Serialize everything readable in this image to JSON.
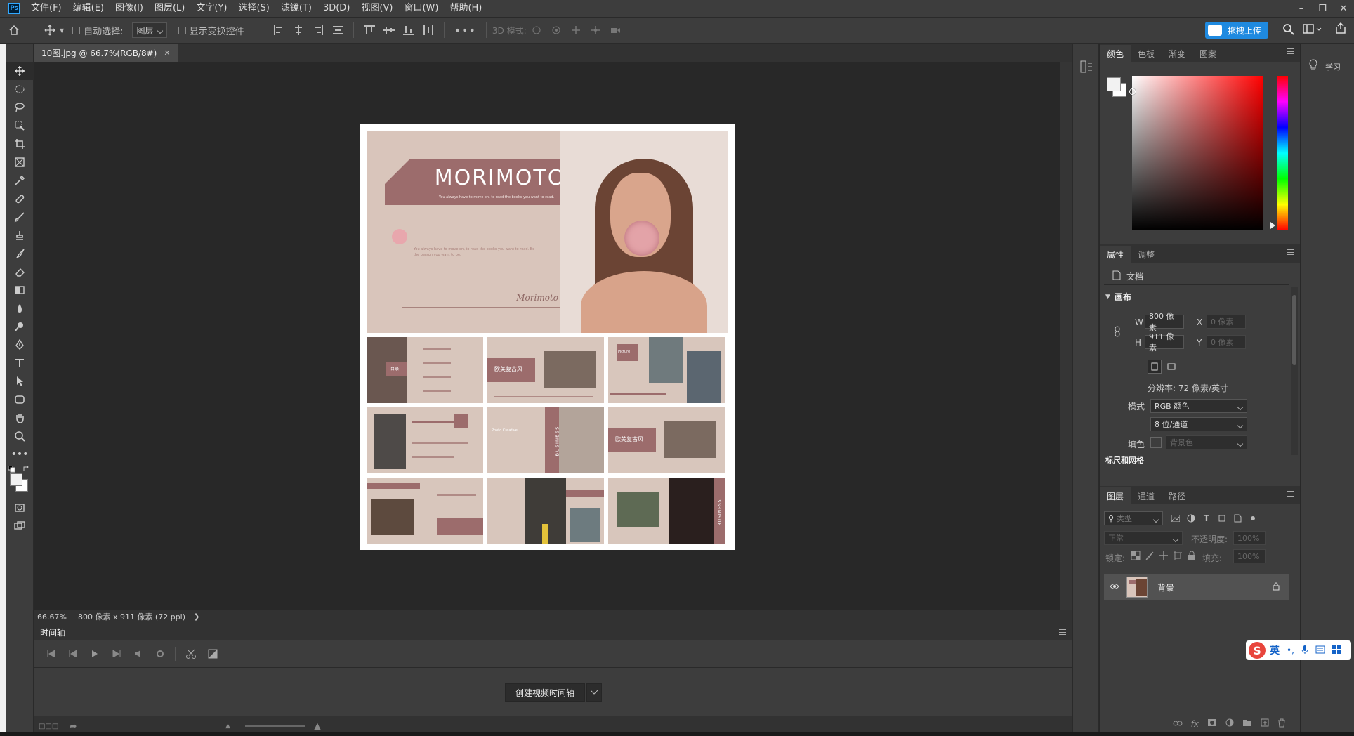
{
  "app": {
    "logo": "Ps"
  },
  "menu": [
    "文件(F)",
    "编辑(E)",
    "图像(I)",
    "图层(L)",
    "文字(Y)",
    "选择(S)",
    "滤镜(T)",
    "3D(D)",
    "视图(V)",
    "窗口(W)",
    "帮助(H)"
  ],
  "options": {
    "auto_select_label": "自动选择:",
    "auto_select_value": "图层",
    "show_transform_label": "显示变换控件",
    "mode3d_label": "3D 模式:",
    "upload_label": "拖拽上传"
  },
  "document": {
    "tab_title": "10图.jpg @ 66.7%(RGB/8#)",
    "zoom": "66.67%",
    "size_info": "800 像素 x 911 像素 (72 ppi)"
  },
  "artboard": {
    "brand": "MORIMOTO",
    "tagline": "You always have to move on, to read the books you want to read.",
    "body_text": "You always have to move on, to read the books you want to read. Be the person you want to be.",
    "signature": "Morimoto",
    "tag_vintage": "欧美复古风",
    "tag_business": "BUSINESS",
    "tag_picture": "Picture",
    "tag_item": "目录",
    "tag_photo": "Photo Creative"
  },
  "timeline": {
    "title": "时间轴",
    "create_label": "创建视频时间轴"
  },
  "color_panel": {
    "tabs": [
      "颜色",
      "色板",
      "渐变",
      "图案"
    ],
    "hue_colors": [
      "#ff0000",
      "#ff00ff",
      "#0000ff",
      "#00ffff",
      "#00ff00",
      "#ffff00",
      "#ff0000"
    ]
  },
  "properties": {
    "tabs": [
      "属性",
      "调整"
    ],
    "doc_label": "文档",
    "section_canvas": "画布",
    "w_label": "W",
    "w_value": "800 像素",
    "h_label": "H",
    "h_value": "911 像素",
    "x_label": "X",
    "x_value": "0 像素",
    "y_label": "Y",
    "y_value": "0 像素",
    "resolution": "分辨率: 72 像素/英寸",
    "mode_label": "模式",
    "mode_value": "RGB 颜色",
    "bit_value": "8 位/通道",
    "fill_label": "填色",
    "fill_value": "背景色",
    "section_next": "标尺和网格"
  },
  "layers": {
    "tabs": [
      "图层",
      "通道",
      "路径"
    ],
    "filter_placeholder": "类型",
    "blend_mode": "正常",
    "opacity_label": "不透明度:",
    "opacity_value": "100%",
    "lock_label": "锁定:",
    "fill_label": "填充:",
    "fill_value": "100%",
    "layer_name": "背景"
  },
  "far_right": {
    "learn_label": "学习"
  },
  "ime": {
    "lang": "英"
  }
}
